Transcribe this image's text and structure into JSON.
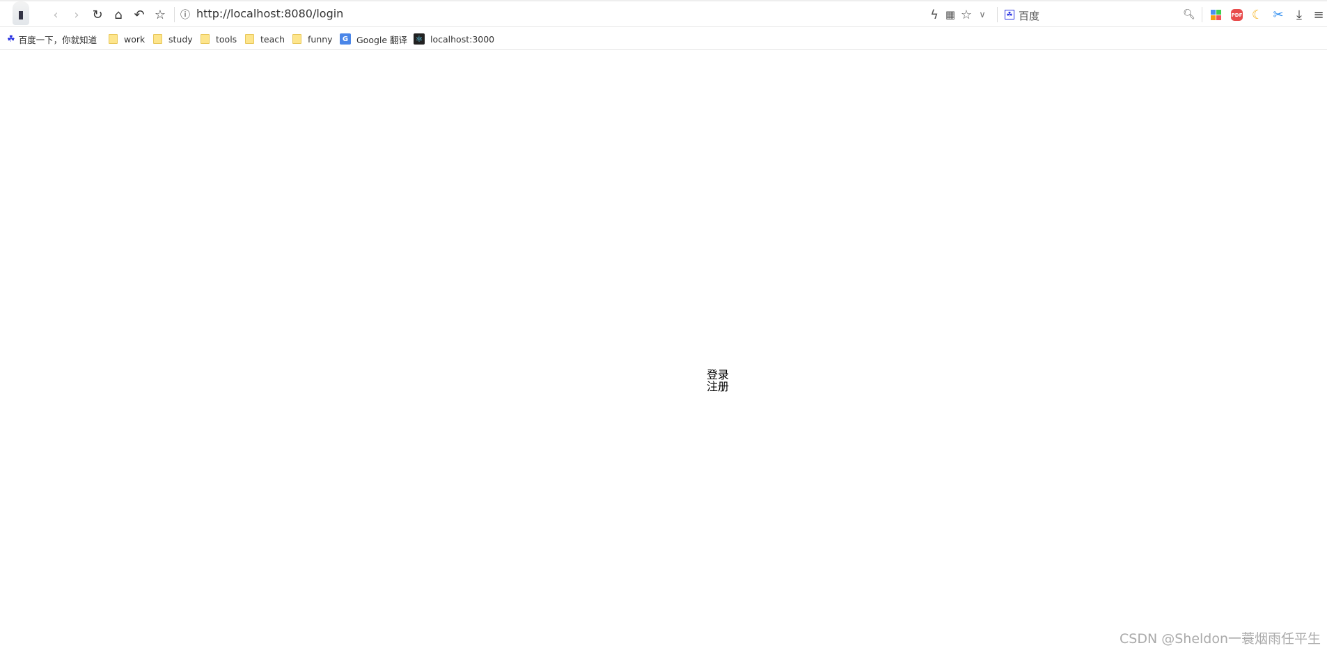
{
  "browser": {
    "url": "http://localhost:8080/login",
    "search_engine_label": "百度",
    "icons": [
      "avatar",
      "back-icon",
      "forward-icon",
      "reload-icon",
      "home-icon",
      "undo-icon",
      "star-icon",
      "info-icon",
      "bolt-icon",
      "qr-icon",
      "star-icon",
      "chevron-down-icon",
      "baidu-icon",
      "search-icon",
      "apps-icon",
      "pdf-icon",
      "moon-icon",
      "scissors-icon",
      "download-icon",
      "menu-icon"
    ]
  },
  "bookmarks": [
    {
      "label": "百度一下，你就知道",
      "icon": "baidu-paw-icon"
    },
    {
      "label": "work",
      "icon": "folder-icon"
    },
    {
      "label": "study",
      "icon": "folder-icon"
    },
    {
      "label": "tools",
      "icon": "folder-icon"
    },
    {
      "label": "teach",
      "icon": "folder-icon"
    },
    {
      "label": "funny",
      "icon": "folder-icon"
    },
    {
      "label": "Google 翻译",
      "icon": "google-translate-icon"
    },
    {
      "label": "localhost:3000",
      "icon": "react-icon"
    }
  ],
  "page": {
    "login_link": "登录",
    "register_link": "注册"
  },
  "watermark": "CSDN @Sheldon一蓑烟雨任平生"
}
